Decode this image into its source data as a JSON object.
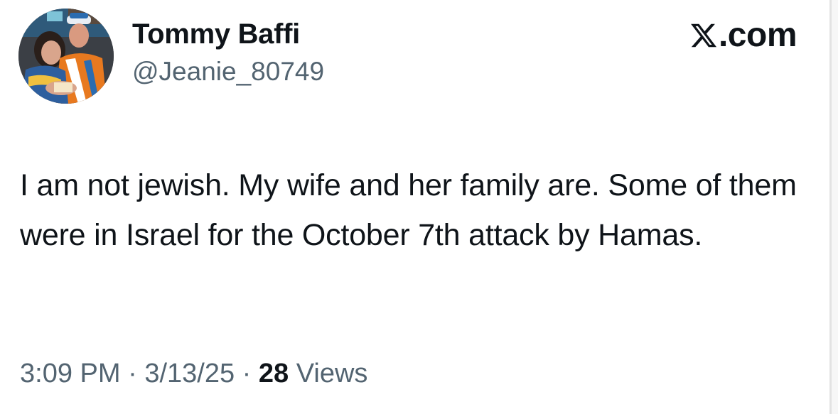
{
  "author": {
    "display_name": "Tommy Baffi",
    "handle": "@Jeanie_80749"
  },
  "brand": {
    "domain": "X.com",
    "icon": "x-logo-icon"
  },
  "tweet": {
    "text": "I am not jewish. My wife and her family are. Some of them were in Israel for the October 7th attack by Hamas.",
    "time": "3:09 PM",
    "date": "3/13/25",
    "separator": "·",
    "views_count": "28",
    "views_label": "Views"
  },
  "colors": {
    "text_primary": "#0f1419",
    "text_secondary": "#536471",
    "background": "#ffffff"
  }
}
